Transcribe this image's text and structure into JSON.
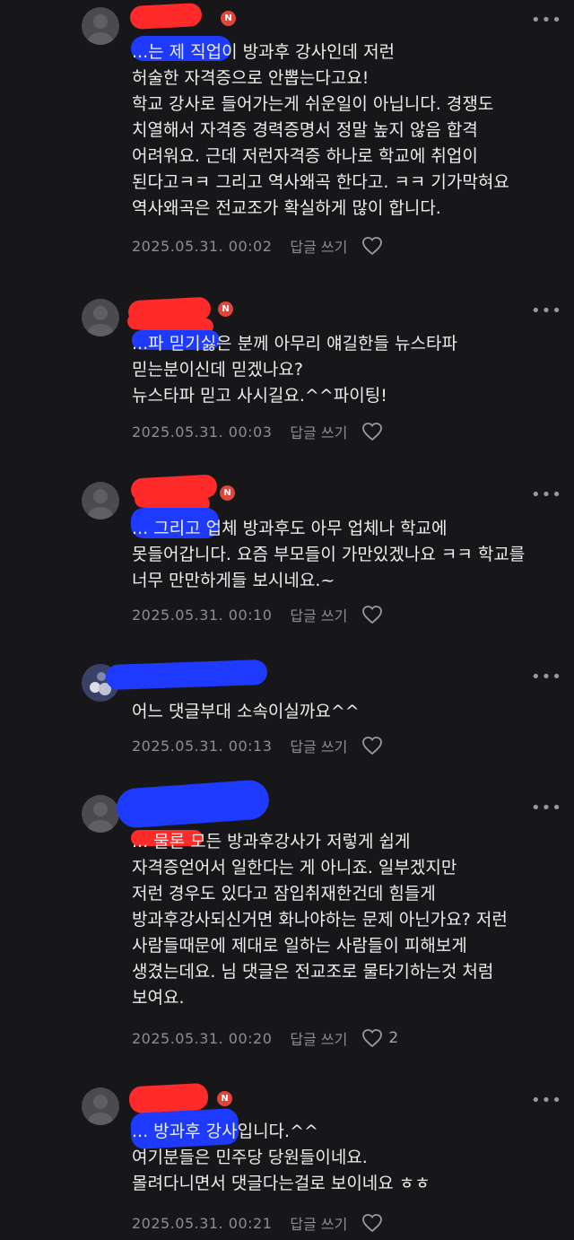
{
  "comments": [
    {
      "text": "...는 제 직업이 방과후 강사인데 저런\n허술한 자격증으로 안뽑는다고요!\n학교 강사로 들어가는게 쉬운일이 아닙니다. 경쟁도\n치열해서 자격증 경력증명서 정말 높지 않음 합격\n어려워요. 근데 저런자격증 하나로 학교에 취업이\n된다고ㅋㅋ 그리고 역사왜곡 한다고. ㅋㅋ 기가막혀요\n역사왜곡은 전교조가 확실하게 많이 합니다.",
      "date": "2025.05.31. 00:02",
      "reply": "답글 쓰기",
      "likes": ""
    },
    {
      "text": "...파 믿기싫은 분께 아무리 얘길한들 뉴스타파\n믿는분이신데 믿겠나요?\n뉴스타파 믿고 사시길요.^^파이팅!",
      "date": "2025.05.31. 00:03",
      "reply": "답글 쓰기",
      "likes": ""
    },
    {
      "text": "... 그리고 업체 방과후도 아무 업체나 학교에\n못들어갑니다. 요즘 부모들이 가만있겠나요 ㅋㅋ 학교를\n너무 만만하게들 보시네요.~",
      "date": "2025.05.31. 00:10",
      "reply": "답글 쓰기",
      "likes": ""
    },
    {
      "text": "어느 댓글부대 소속이실까요^^",
      "date": "2025.05.31. 00:13",
      "reply": "답글 쓰기",
      "likes": ""
    },
    {
      "text": "... 물론 모든 방과후강사가 저렇게 쉽게\n자격증얻어서 일한다는 게 아니죠. 일부겠지만\n저런 경우도 있다고 잠입취재한건데 힘들게\n방과후강사되신거면 화나야하는 문제 아닌가요? 저런\n사람들때문에 제대로 일하는 사람들이 피해보게\n생겼는데요. 님 댓글은 전교조로 물타기하는것 처럼\n보여요.",
      "date": "2025.05.31. 00:20",
      "reply": "답글 쓰기",
      "likes": "2"
    },
    {
      "text": "... 방과후 강사입니다.^^\n여기분들은 민주당 당원들이네요.\n몰려다니면서 댓글다는걸로 보이네요 ㅎㅎ",
      "date": "2025.05.31. 00:21",
      "reply": "답글 쓰기",
      "likes": ""
    }
  ],
  "badge_letter": "N",
  "more_glyph": "•••",
  "colors": {
    "background": "#17171a",
    "text": "#ededed",
    "meta": "#8d8d92",
    "badge": "#e0443a"
  }
}
